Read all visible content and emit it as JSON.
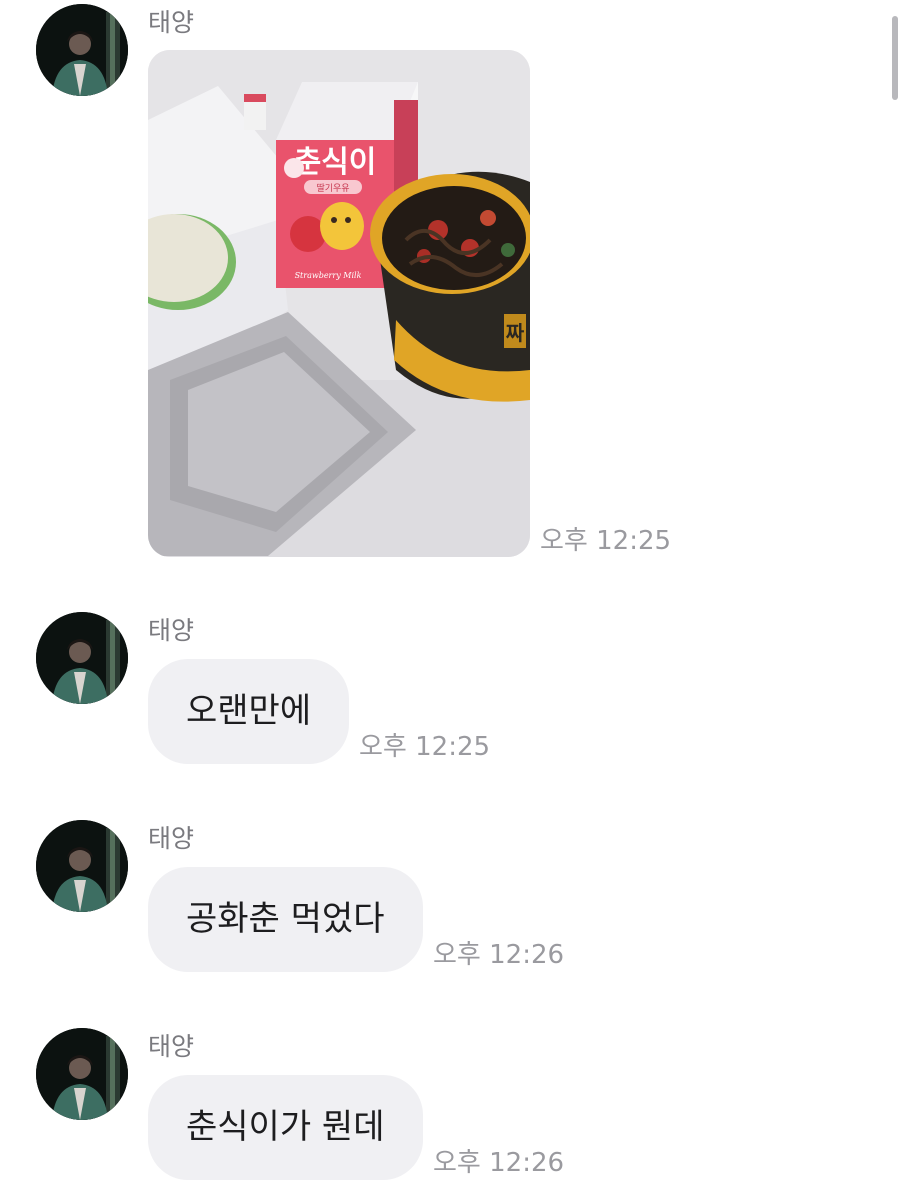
{
  "messages": [
    {
      "sender": "태양",
      "type": "image",
      "time": "오후 12:25"
    },
    {
      "sender": "태양",
      "type": "text",
      "text": "오랜만에",
      "time": "오후 12:25"
    },
    {
      "sender": "태양",
      "type": "text",
      "text": "공화춘 먹었다",
      "time": "오후 12:26"
    },
    {
      "sender": "태양",
      "type": "text",
      "text": "춘식이가 뭔데",
      "time": "오후 12:26"
    }
  ],
  "photo": {
    "milk_carton_brand": "춘식이",
    "milk_carton_flavor": "딸기우유",
    "milk_carton_english": "Strawberry Milk",
    "noodle_bowl_tag": "짜"
  },
  "colors": {
    "bubble_background": "#f0f0f3",
    "message_text": "#1d1d1f",
    "sender_name": "#7a7a7f",
    "timestamp": "#9a9a9f",
    "carton_pink": "#e9536c",
    "bowl_gold": "#e0a526"
  },
  "icons": {
    "avatar": "profile-photo"
  }
}
